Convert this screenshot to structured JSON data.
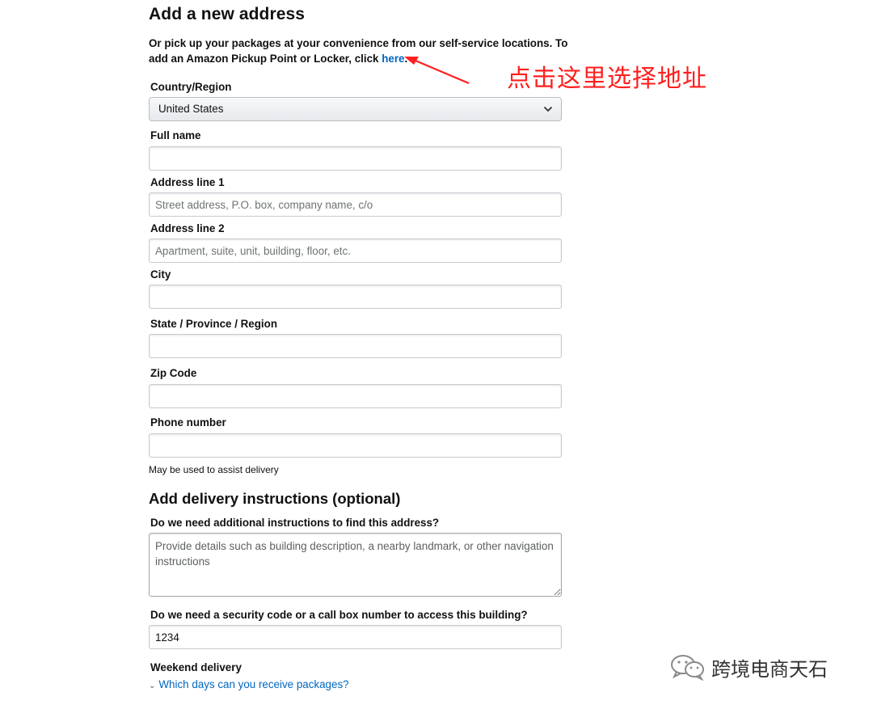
{
  "page_title": "Add a new address",
  "intro": {
    "text": "Or pick up your packages at your convenience from our self-service locations. To add an Amazon Pickup Point or Locker, click ",
    "link": "here",
    "after_link": "."
  },
  "annotation": "点击这里选择地址",
  "colors": {
    "link": "#0066c0",
    "annotation": "#ff1f1f"
  },
  "form": {
    "country": {
      "label": "Country/Region",
      "value": "United States"
    },
    "full_name": {
      "label": "Full name",
      "value": "",
      "placeholder": ""
    },
    "address1": {
      "label": "Address line 1",
      "value": "",
      "placeholder": "Street address, P.O. box, company name, c/o"
    },
    "address2": {
      "label": "Address line 2",
      "value": "",
      "placeholder": "Apartment, suite, unit, building, floor, etc."
    },
    "city": {
      "label": "City",
      "value": "",
      "placeholder": ""
    },
    "state": {
      "label": "State / Province / Region",
      "value": "",
      "placeholder": ""
    },
    "zip": {
      "label": "Zip Code",
      "value": "",
      "placeholder": ""
    },
    "phone": {
      "label": "Phone number",
      "value": "",
      "placeholder": "",
      "helper": "May be used to assist delivery"
    }
  },
  "delivery": {
    "heading": "Add delivery instructions (optional)",
    "find_address": {
      "label": "Do we need additional instructions to find this address?",
      "placeholder": "Provide details such as building description, a nearby landmark, or other navigation instructions"
    },
    "security_code": {
      "label": "Do we need a security code or a call box number to access this building?",
      "value": "1234"
    },
    "weekend": {
      "label": "Weekend delivery",
      "link": "Which days can you receive packages?"
    }
  },
  "watermark": {
    "icon": "wechat-icon",
    "text": "跨境电商天石"
  }
}
